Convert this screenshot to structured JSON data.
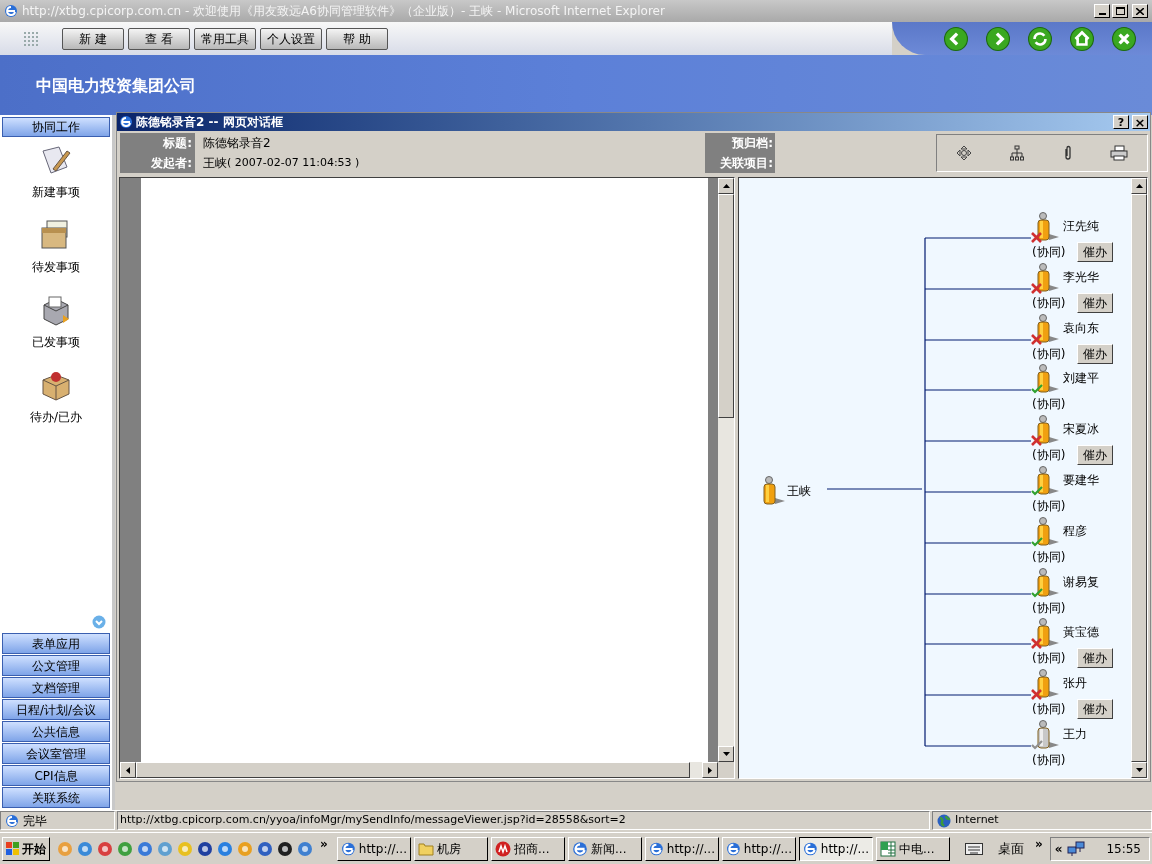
{
  "window": {
    "title": "http://xtbg.cpicorp.com.cn - 欢迎使用《用友致远A6协同管理软件》（企业版）- 王峡 - Microsoft Internet Explorer"
  },
  "toolbar": {
    "buttons": [
      "新 建",
      "查 看",
      "常用工具",
      "个人设置",
      "帮 助"
    ]
  },
  "header": {
    "company": "中国电力投资集团公司"
  },
  "sidebar": {
    "section": "协同工作",
    "items": [
      {
        "label": "新建事项",
        "kind": "new"
      },
      {
        "label": "待发事项",
        "kind": "draft"
      },
      {
        "label": "已发事项",
        "kind": "sent"
      },
      {
        "label": "待办/已办",
        "kind": "todo"
      }
    ],
    "menu": [
      "表单应用",
      "公文管理",
      "文档管理",
      "日程/计划/会议",
      "公共信息",
      "会议室管理",
      "CPI信息",
      "关联系统"
    ]
  },
  "dialog": {
    "title": "陈德铭录音2 -- 网页对话框",
    "help": "?",
    "close": "×",
    "fields": [
      {
        "label": "标题:",
        "value": "陈德铭录音2"
      },
      {
        "label": "发起者:",
        "value": "王峡",
        "time": "( 2007-02-07 11:04:53 )"
      }
    ],
    "side_fields": [
      {
        "label": "预归档:"
      },
      {
        "label": "关联项目:"
      }
    ],
    "flow": {
      "root": "王峡",
      "nodes": [
        {
          "name": "汪先纯",
          "role": "(协同)",
          "done": false,
          "disabled": false,
          "action": "催办"
        },
        {
          "name": "李光华",
          "role": "(协同)",
          "done": false,
          "disabled": false,
          "action": "催办"
        },
        {
          "name": "袁向东",
          "role": "(协同)",
          "done": false,
          "disabled": false,
          "action": "催办"
        },
        {
          "name": "刘建平",
          "role": "(协同)",
          "done": true,
          "disabled": false
        },
        {
          "name": "宋夏冰",
          "role": "(协同)",
          "done": false,
          "disabled": false,
          "action": "催办"
        },
        {
          "name": "要建华",
          "role": "(协同)",
          "done": true,
          "disabled": false
        },
        {
          "name": "程彦",
          "role": "(协同)",
          "done": true,
          "disabled": false
        },
        {
          "name": "谢易复",
          "role": "(协同)",
          "done": true,
          "disabled": false
        },
        {
          "name": "黃宝德",
          "role": "(协同)",
          "done": false,
          "disabled": false,
          "action": "催办"
        },
        {
          "name": "张丹",
          "role": "(协同)",
          "done": false,
          "disabled": false,
          "action": "催办"
        },
        {
          "name": "王力",
          "role": "(协同)",
          "done": true,
          "disabled": true
        }
      ]
    }
  },
  "status_bar": {
    "state": "完毕",
    "url": "http://xtbg.cpicorp.com.cn/yyoa/infoMgr/mySendInfo/messageViewer.jsp?id=28558&sort=2",
    "zone": "Internet"
  },
  "taskbar": {
    "start": "开始",
    "more": "»",
    "tasks": [
      {
        "label": "http://...",
        "kind": "ie",
        "selected": false
      },
      {
        "label": "机房",
        "kind": "folder",
        "selected": false
      },
      {
        "label": "招商...",
        "kind": "red",
        "selected": false
      },
      {
        "label": "新闻...",
        "kind": "ie",
        "selected": false
      },
      {
        "label": "http://...",
        "kind": "ie",
        "selected": false
      },
      {
        "label": "http://...",
        "kind": "ie",
        "selected": false
      },
      {
        "label": "http://...",
        "kind": "ie",
        "selected": true
      },
      {
        "label": "中电...",
        "kind": "excel",
        "selected": false
      }
    ],
    "desktop": "桌面",
    "desktop_more": "»",
    "tray_toggle": "«",
    "clock": "15:55"
  }
}
